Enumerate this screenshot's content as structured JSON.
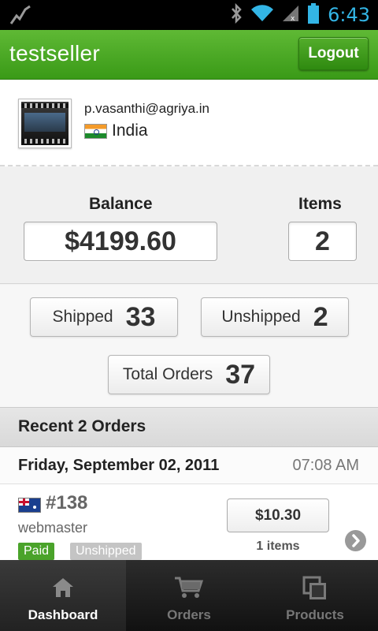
{
  "status_bar": {
    "time": "6:43",
    "icons": [
      "activity-icon",
      "bluetooth-icon",
      "wifi-icon",
      "signal-icon",
      "battery-icon"
    ]
  },
  "header": {
    "title": "testseller",
    "logout_label": "Logout",
    "accent": "#4aa92a"
  },
  "profile": {
    "email": "p.vasanthi@agriya.in",
    "country": "India"
  },
  "stats": {
    "balance_label": "Balance",
    "balance_value": "$4199.60",
    "items_label": "Items",
    "items_value": "2"
  },
  "counts": {
    "shipped_label": "Shipped",
    "shipped_value": "33",
    "unshipped_label": "Unshipped",
    "unshipped_value": "2",
    "total_label": "Total Orders",
    "total_value": "37"
  },
  "recent": {
    "heading": "Recent 2 Orders",
    "date": "Friday, September 02, 2011",
    "time": "07:08 AM",
    "order": {
      "id": "#138",
      "buyer": "webmaster",
      "paid_badge": "Paid",
      "ship_badge": "Unshipped",
      "price": "$10.30",
      "items": "1 items"
    }
  },
  "tabs": [
    {
      "label": "Dashboard",
      "icon": "home-icon"
    },
    {
      "label": "Orders",
      "icon": "cart-icon"
    },
    {
      "label": "Products",
      "icon": "products-icon"
    }
  ]
}
